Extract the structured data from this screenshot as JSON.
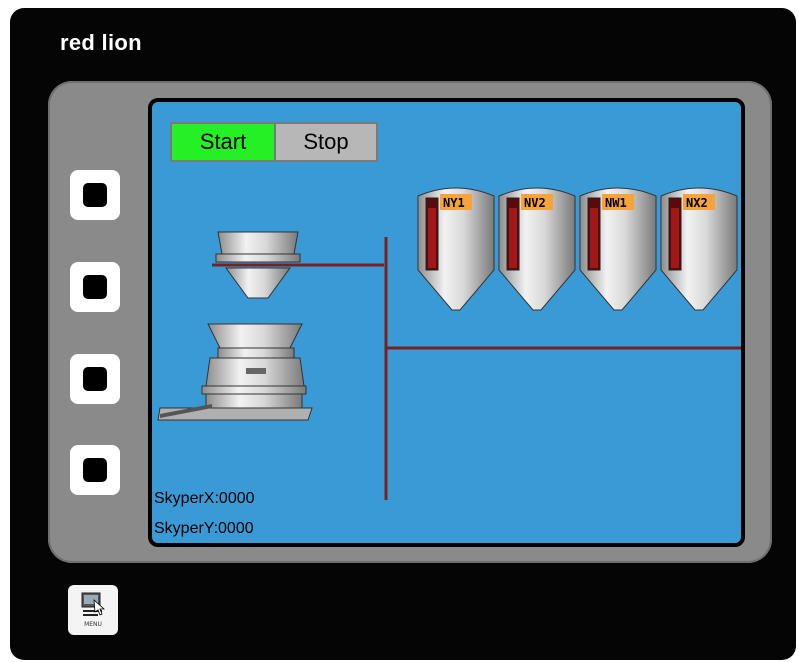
{
  "brand": {
    "logo_text": "red lion"
  },
  "softkeys": [
    {
      "name": "softkey-1"
    },
    {
      "name": "softkey-2"
    },
    {
      "name": "softkey-3"
    },
    {
      "name": "softkey-4"
    }
  ],
  "menu": {
    "label": "MENU"
  },
  "screen": {
    "controls": {
      "start_label": "Start",
      "stop_label": "Stop"
    },
    "silos": [
      {
        "label": "NY1",
        "fill_fraction": 0.85
      },
      {
        "label": "NV2",
        "fill_fraction": 0.85
      },
      {
        "label": "NW1",
        "fill_fraction": 0.85
      },
      {
        "label": "NX2",
        "fill_fraction": 0.85
      }
    ],
    "readouts": {
      "skyper_x": "SkyperX:0000",
      "skyper_y": "SkyperY:0000"
    }
  },
  "colors": {
    "screen_bg": "#3a9ad6",
    "pipe": "#7a2020",
    "start_active": "#25f025",
    "stop_idle": "#b7b7b7",
    "label_bg": "#f5a33a",
    "level_fill": "#a01818"
  }
}
